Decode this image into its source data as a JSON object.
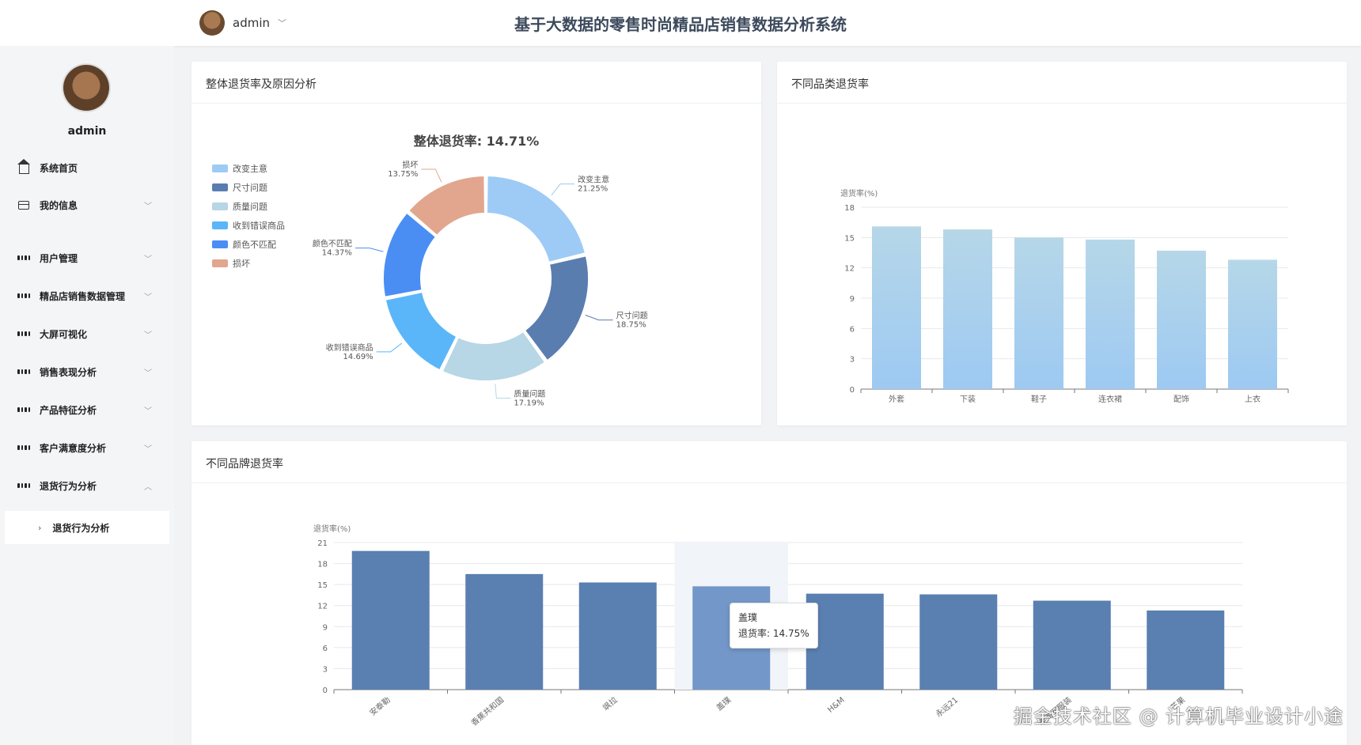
{
  "header": {
    "user": "admin",
    "title": "基于大数据的零售时尚精品店销售数据分析系统"
  },
  "sidebar": {
    "username": "admin",
    "items": [
      {
        "label": "系统首页",
        "icon": "home-icon",
        "chevron": false
      },
      {
        "label": "我的信息",
        "icon": "card-icon",
        "chevron": true
      },
      {
        "label": "用户管理",
        "icon": "grid-icon",
        "chevron": true
      },
      {
        "label": "精品店销售数据管理",
        "icon": "grid-icon",
        "chevron": true
      },
      {
        "label": "大屏可视化",
        "icon": "grid-icon",
        "chevron": true
      },
      {
        "label": "销售表现分析",
        "icon": "grid-icon",
        "chevron": true
      },
      {
        "label": "产品特征分析",
        "icon": "grid-icon",
        "chevron": true
      },
      {
        "label": "客户满意度分析",
        "icon": "grid-icon",
        "chevron": true
      },
      {
        "label": "退货行为分析",
        "icon": "grid-icon",
        "chevron": true,
        "expanded": true
      }
    ],
    "submenu": {
      "label": "退货行为分析"
    }
  },
  "panels": {
    "reasons": {
      "title": "整体退货率及原因分析"
    },
    "category": {
      "title": "不同品类退货率"
    },
    "brand": {
      "title": "不同品牌退货率"
    }
  },
  "tooltip": {
    "name": "盖璞",
    "text": "退货率: 14.75%"
  },
  "watermark": "掘金技术社区 @ 计算机毕业设计小途",
  "chart_data": [
    {
      "type": "pie",
      "title": "整体退货率: 14.71%",
      "legend_position": "left",
      "slices": [
        {
          "label": "改变主意",
          "value": 21.25,
          "display": "21.25%",
          "color": "#9dcbf5"
        },
        {
          "label": "尺寸问题",
          "value": 18.75,
          "display": "18.75%",
          "color": "#5a7db0"
        },
        {
          "label": "质量问题",
          "value": 17.19,
          "display": "17.19%",
          "color": "#b7d6e6"
        },
        {
          "label": "收到错误商品",
          "value": 14.69,
          "display": "14.69%",
          "color": "#5ab6f8"
        },
        {
          "label": "颜色不匹配",
          "value": 14.37,
          "display": "14.37%",
          "color": "#4a8ef4"
        },
        {
          "label": "损坏",
          "value": 13.75,
          "display": "13.75%",
          "color": "#e2a68e"
        }
      ]
    },
    {
      "type": "bar",
      "ylabel": "退货率(%)",
      "ylim": [
        0,
        18
      ],
      "yticks": [
        0,
        3,
        6,
        9,
        12,
        15,
        18
      ],
      "categories": [
        "外套",
        "下装",
        "鞋子",
        "连衣裙",
        "配饰",
        "上衣"
      ],
      "values": [
        16.1,
        15.8,
        15.0,
        14.8,
        13.7,
        12.8
      ],
      "color_top": "#b6d7e8",
      "color_bottom": "#9dc9f2",
      "grid": true
    },
    {
      "type": "bar",
      "ylabel": "退货率(%)",
      "ylim": [
        0,
        21
      ],
      "yticks": [
        0,
        3,
        6,
        9,
        12,
        15,
        18,
        21
      ],
      "categories": [
        "安泰勒",
        "香蕉共和国",
        "飒拉",
        "盖璞",
        "H&M",
        "永远21",
        "老海军服装",
        "芒果"
      ],
      "values": [
        19.8,
        16.5,
        15.3,
        14.75,
        13.7,
        13.6,
        12.7,
        11.3
      ],
      "color": "#5a7fb1",
      "highlight_color": "#7397c8",
      "highlight_index": 3,
      "grid": true
    }
  ]
}
